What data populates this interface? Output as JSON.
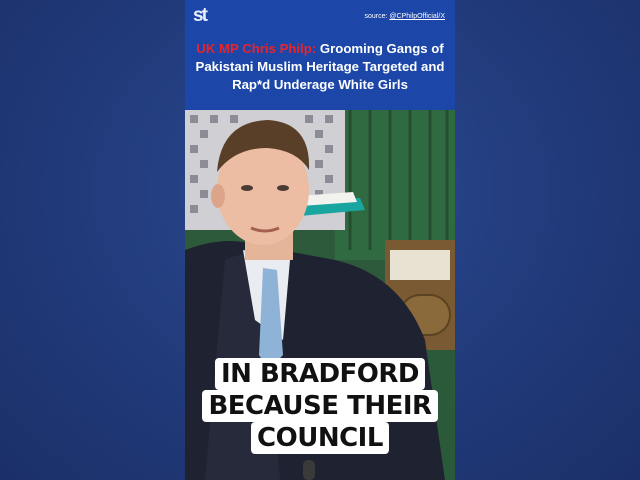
{
  "header": {
    "logo_text": "st",
    "source_prefix": "source: ",
    "source_handle": "@CPhilpOfficial/X",
    "headline_red": "UK MP Chris Philp:",
    "headline_rest": " Grooming Gangs of Pakistani Muslim Heritage Targeted and Rap*d Underage White Girls"
  },
  "caption": {
    "lines": [
      "IN BRADFORD",
      "BECAUSE THEIR",
      "COUNCIL"
    ]
  },
  "colors": {
    "page_background": "#243f82",
    "header_background": "#1c46a8",
    "headline_accent": "#e8242c",
    "caption_background": "#ffffff"
  }
}
